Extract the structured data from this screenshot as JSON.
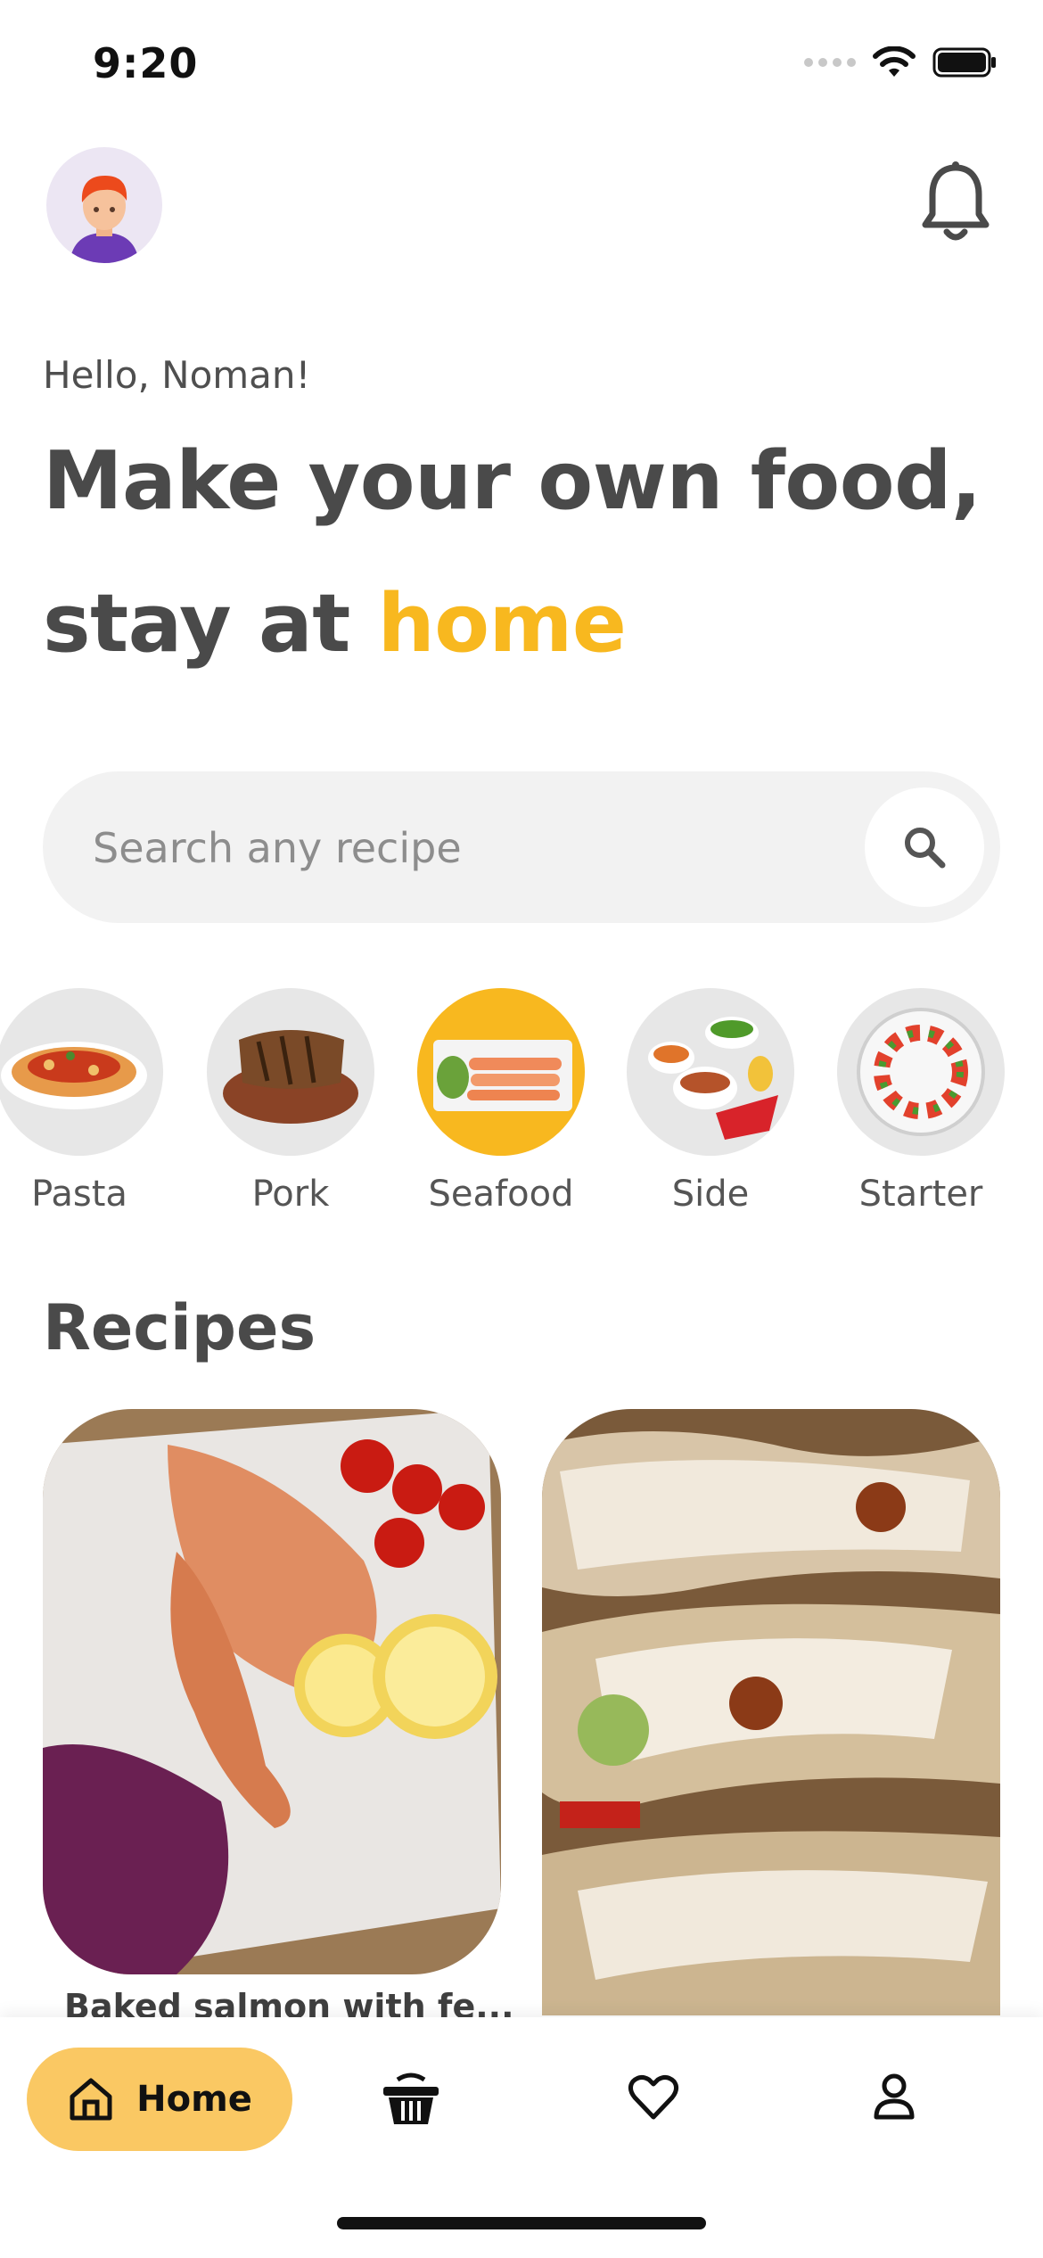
{
  "status_bar": {
    "time": "9:20"
  },
  "header": {
    "greeting": "Hello, Noman!",
    "headline_line1": "Make your own food,",
    "headline_line2_prefix": "stay at ",
    "headline_accent": "home"
  },
  "search": {
    "placeholder": "Search any recipe",
    "value": ""
  },
  "categories": [
    {
      "label": "Pasta",
      "active": false
    },
    {
      "label": "Pork",
      "active": false
    },
    {
      "label": "Seafood",
      "active": true
    },
    {
      "label": "Side",
      "active": false
    },
    {
      "label": "Starter",
      "active": false
    }
  ],
  "recipes": {
    "title": "Recipes",
    "items": [
      {
        "name": "Baked salmon with fe..."
      },
      {
        "name": ""
      }
    ]
  },
  "bottom_nav": {
    "items": [
      {
        "label": "Home",
        "icon": "home-icon",
        "active": true
      },
      {
        "label": "",
        "icon": "basket-icon",
        "active": false
      },
      {
        "label": "",
        "icon": "heart-icon",
        "active": false
      },
      {
        "label": "",
        "icon": "user-icon",
        "active": false
      }
    ]
  },
  "colors": {
    "accent": "#f8b81f",
    "nav_active": "#fac863",
    "text": "#4a4a4a"
  }
}
